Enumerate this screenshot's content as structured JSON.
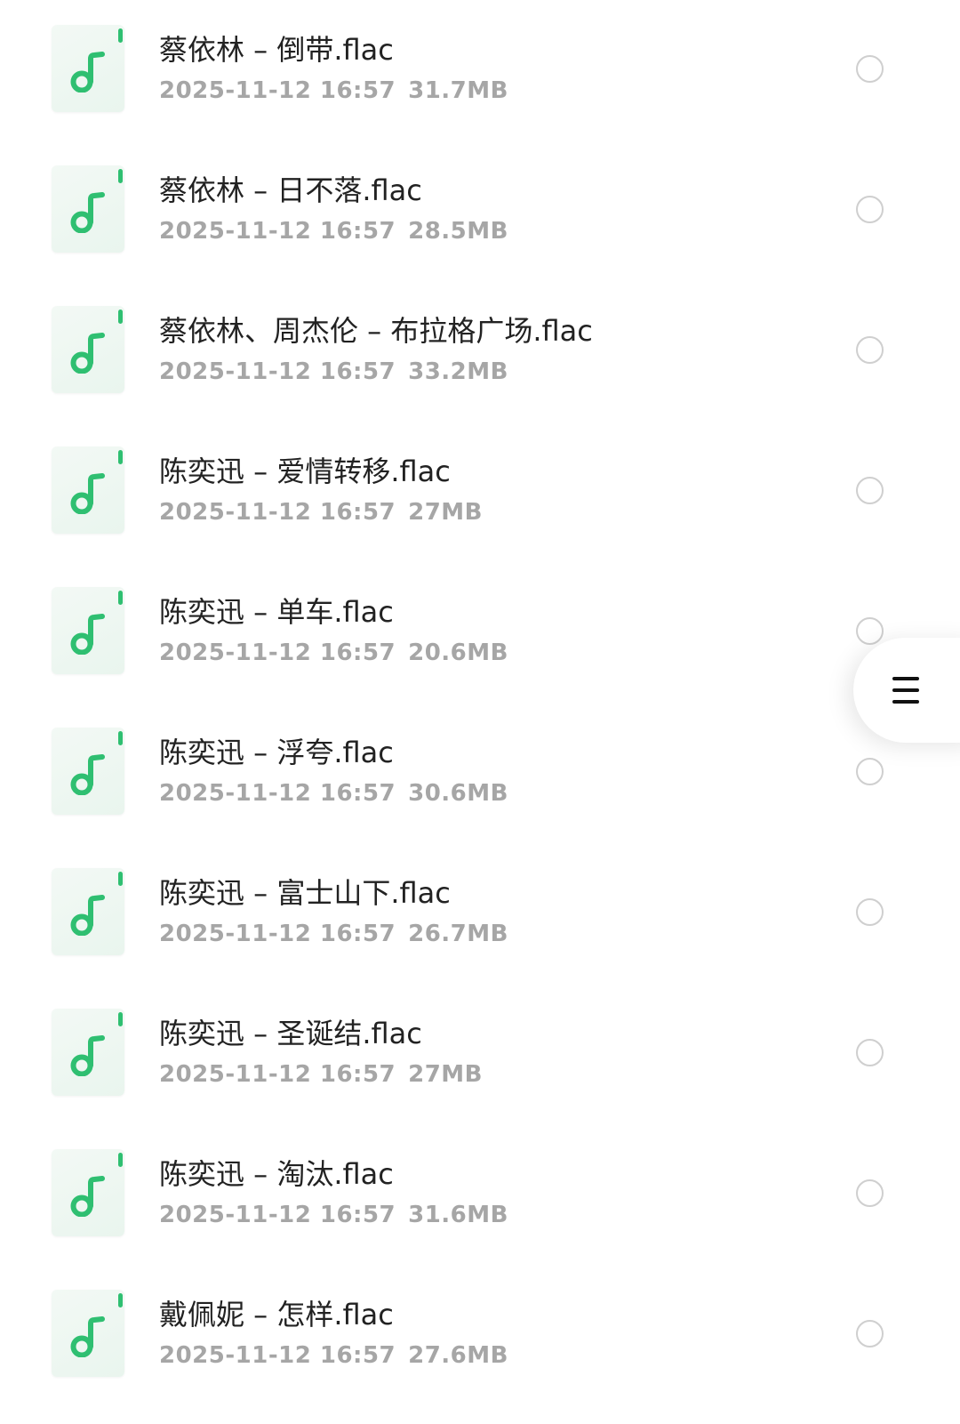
{
  "files": [
    {
      "name": "蔡依林 – 倒带.flac",
      "date": "2025-11-12 16:57",
      "size": "31.7MB",
      "icon": "music-file-icon"
    },
    {
      "name": "蔡依林 – 日不落.flac",
      "date": "2025-11-12 16:57",
      "size": "28.5MB",
      "icon": "music-file-icon"
    },
    {
      "name": "蔡依林、周杰伦 – 布拉格广场.flac",
      "date": "2025-11-12 16:57",
      "size": "33.2MB",
      "icon": "music-file-icon"
    },
    {
      "name": "陈奕迅 – 爱情转移.flac",
      "date": "2025-11-12 16:57",
      "size": "27MB",
      "icon": "music-file-icon"
    },
    {
      "name": "陈奕迅 – 单车.flac",
      "date": "2025-11-12 16:57",
      "size": "20.6MB",
      "icon": "music-file-icon"
    },
    {
      "name": "陈奕迅 – 浮夸.flac",
      "date": "2025-11-12 16:57",
      "size": "30.6MB",
      "icon": "music-file-icon"
    },
    {
      "name": "陈奕迅 – 富士山下.flac",
      "date": "2025-11-12 16:57",
      "size": "26.7MB",
      "icon": "music-file-icon"
    },
    {
      "name": "陈奕迅 – 圣诞结.flac",
      "date": "2025-11-12 16:57",
      "size": "27MB",
      "icon": "music-file-icon"
    },
    {
      "name": "陈奕迅 – 淘汰.flac",
      "date": "2025-11-12 16:57",
      "size": "31.6MB",
      "icon": "music-file-icon"
    },
    {
      "name": "戴佩妮 – 怎样.flac",
      "date": "2025-11-12 16:57",
      "size": "27.6MB",
      "icon": "music-file-icon"
    }
  ],
  "menu_button": {
    "icon": "hamburger-menu-icon"
  },
  "colors": {
    "accent": "#2fbf71",
    "file_name": "#222222",
    "file_meta": "#a6a6a6",
    "radio_border": "#cfcfcf"
  }
}
